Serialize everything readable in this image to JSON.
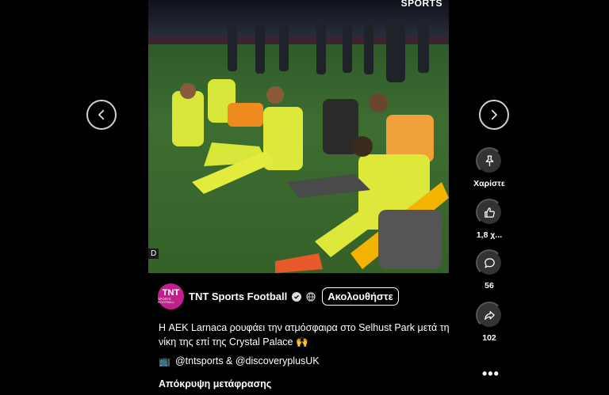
{
  "video": {
    "watermark": "SPORTS",
    "score_fragment": "D"
  },
  "channel": {
    "avatar_line1": "TNT",
    "avatar_line2": "SPORTS FOOTBALL",
    "name": "TNT Sports Football",
    "follow_label": "Ακολουθήστε"
  },
  "post": {
    "caption": "Η AEK Larnaca ρουφάει την ατμόσφαιρα στο Selhust Park μετά τη νίκη της επί της Crystal Palace 🙌",
    "credits": "@tntsports & @discoveryplusUK",
    "hide_translation": "Απόκρυψη μετάφρασης"
  },
  "actions": {
    "remix_label": "Χαρίστε",
    "likes": "1,8 χ...",
    "comments": "56",
    "shares": "102"
  },
  "colors": {
    "avatar_bg": "#c21e8c",
    "rail_button_bg": "#333333"
  }
}
